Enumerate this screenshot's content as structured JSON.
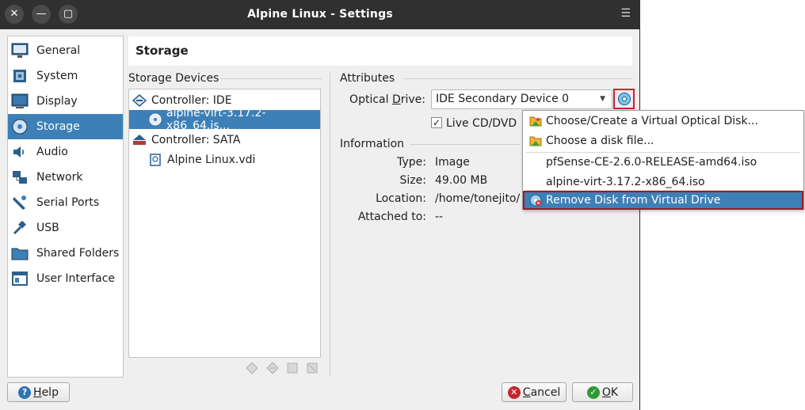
{
  "window": {
    "title": "Alpine Linux - Settings",
    "close_glyph": "✕",
    "minimize_glyph": "—",
    "maximize_glyph": "▢",
    "menu_glyph": "☰"
  },
  "sidebar": {
    "items": [
      {
        "label": "General",
        "icon": "general-icon"
      },
      {
        "label": "System",
        "icon": "system-icon"
      },
      {
        "label": "Display",
        "icon": "display-icon"
      },
      {
        "label": "Storage",
        "icon": "storage-icon",
        "selected": true
      },
      {
        "label": "Audio",
        "icon": "audio-icon"
      },
      {
        "label": "Network",
        "icon": "network-icon"
      },
      {
        "label": "Serial Ports",
        "icon": "serial-ports-icon"
      },
      {
        "label": "USB",
        "icon": "usb-icon"
      },
      {
        "label": "Shared Folders",
        "icon": "shared-folders-icon"
      },
      {
        "label": "User Interface",
        "icon": "user-interface-icon"
      }
    ]
  },
  "page": {
    "title": "Storage"
  },
  "storage_devices": {
    "title": "Storage Devices",
    "tree": [
      {
        "label": "Controller: IDE",
        "icon": "ide-controller-icon"
      },
      {
        "label": "alpine-virt-3.17.2-x86_64.is...",
        "icon": "optical-disc-icon",
        "selected": true
      },
      {
        "label": "Controller: SATA",
        "icon": "sata-controller-icon"
      },
      {
        "label": "Alpine Linux.vdi",
        "icon": "hard-disk-icon"
      }
    ]
  },
  "attributes": {
    "title": "Attributes",
    "optical_drive_label_pre": "Optical ",
    "optical_drive_label_u": "D",
    "optical_drive_label_post": "rive:",
    "optical_drive_value": "IDE Secondary Device 0",
    "live_cd_label": "Live CD/DVD",
    "live_cd_checked": "✓"
  },
  "information": {
    "title": "Information",
    "type_label": "Type:",
    "type_value": "Image",
    "size_label": "Size:",
    "size_value": "49.00 MB",
    "location_label": "Location:",
    "location_value": "/home/tonejito/",
    "attached_label": "Attached to:",
    "attached_value": "--"
  },
  "menu": {
    "items": [
      {
        "label": "Choose/Create a Virtual Optical Disk...",
        "icon": "folder-icon"
      },
      {
        "label": "Choose a disk file...",
        "icon": "folder-icon"
      },
      {
        "label": "pfSense-CE-2.6.0-RELEASE-amd64.iso"
      },
      {
        "label": "alpine-virt-3.17.2-x86_64.iso"
      },
      {
        "label": "Remove Disk from Virtual Drive",
        "icon": "remove-disk-icon",
        "highlighted": true
      }
    ]
  },
  "buttons": {
    "help_u": "H",
    "help_rest": "elp",
    "cancel_u": "C",
    "cancel_rest": "ancel",
    "ok_u": "O",
    "ok_rest": "K"
  },
  "colors": {
    "accent": "#3d80b8",
    "highlight_border": "#d0202c",
    "titlebar": "#303030"
  }
}
